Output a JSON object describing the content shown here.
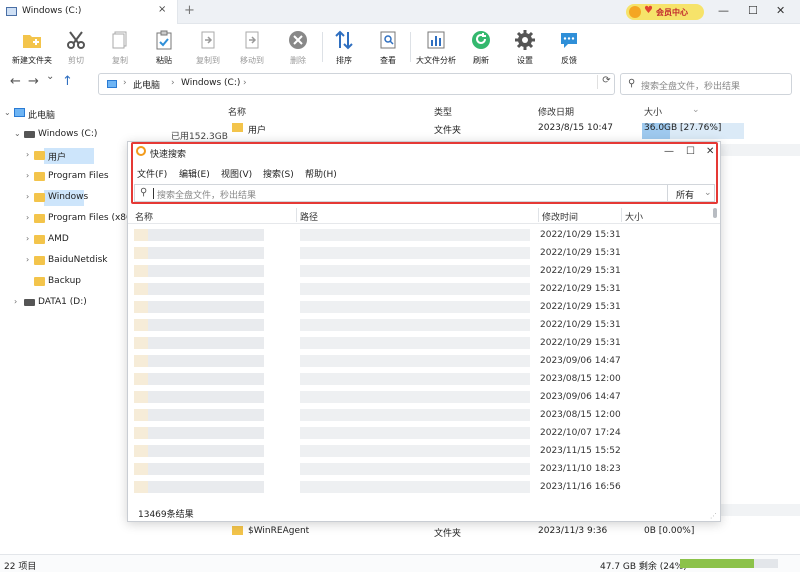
{
  "window": {
    "tab_title": "Windows (C:)",
    "tab_close": "×",
    "new_tab": "+",
    "vip_label": "会员中心",
    "controls": {
      "minimize": "—",
      "maximize": "☐",
      "close": "✕"
    }
  },
  "toolbar": {
    "buttons": [
      {
        "label": "新建文件夹",
        "icon": "new-folder-icon",
        "enabled": true
      },
      {
        "label": "剪切",
        "icon": "scissors-icon",
        "enabled": false
      },
      {
        "label": "复制",
        "icon": "copy-icon",
        "enabled": false
      },
      {
        "label": "粘贴",
        "icon": "paste-icon",
        "enabled": true
      },
      {
        "label": "复制到",
        "icon": "copy-to-icon",
        "enabled": false
      },
      {
        "label": "移动到",
        "icon": "move-to-icon",
        "enabled": false
      },
      {
        "label": "删除",
        "icon": "delete-icon",
        "enabled": false
      },
      {
        "label": "排序",
        "icon": "sort-icon",
        "enabled": true
      },
      {
        "label": "查看",
        "icon": "view-icon",
        "enabled": true
      },
      {
        "label": "大文件分析",
        "icon": "chart-icon",
        "enabled": true
      },
      {
        "label": "刷新",
        "icon": "refresh-icon",
        "enabled": true
      },
      {
        "label": "设置",
        "icon": "gear-icon",
        "enabled": true
      },
      {
        "label": "反馈",
        "icon": "feedback-icon",
        "enabled": true
      }
    ]
  },
  "nav": {
    "back": "←",
    "forward": "→",
    "down": "⌄",
    "up": "↑",
    "breadcrumb": [
      "此电脑",
      "Windows (C:)"
    ],
    "sep": "›",
    "refresh": "⟳",
    "search_placeholder": "搜索全盘文件，秒出结果"
  },
  "tree": {
    "root": "此电脑",
    "drive_c": "Windows (C:)",
    "drive_c_used": "已用152.3GB",
    "folders": [
      "用户",
      "Program Files",
      "Windows",
      "Program Files (x86)",
      "AMD",
      "BaiduNetdisk",
      "Backup"
    ],
    "drive_d": "DATA1 (D:)"
  },
  "filelist": {
    "headers": {
      "name": "名称",
      "type": "类型",
      "date": "修改日期",
      "size": "大小"
    },
    "rows": [
      {
        "name": "用户",
        "type": "文件夹",
        "date": "2023/8/15 10:47",
        "size": "36.0GB [27.76%]",
        "fraction": 0.2776
      },
      {
        "name": "$WinREAgent",
        "type": "文件夹",
        "date": "2023/11/3 9:36",
        "size": "0B [0.00%]",
        "fraction": 0
      }
    ]
  },
  "status": {
    "items": "22 项目",
    "free": "47.7 GB 剩余 (24%)",
    "used_fraction": 0.76
  },
  "quick_search": {
    "title": "快速搜索",
    "controls": {
      "minimize": "—",
      "maximize": "☐",
      "close": "✕"
    },
    "menu": [
      "文件(F)",
      "编辑(E)",
      "视图(V)",
      "搜索(S)",
      "帮助(H)"
    ],
    "search_placeholder": "搜索全盘文件，秒出结果",
    "scope": "所有",
    "columns": {
      "name": "名称",
      "path": "路径",
      "mtime": "修改时间",
      "size": "大小"
    },
    "times": [
      "2022/10/29 15:31",
      "2022/10/29 15:31",
      "2022/10/29 15:31",
      "2022/10/29 15:31",
      "2022/10/29 15:31",
      "2022/10/29 15:31",
      "2022/10/29 15:31",
      "2023/09/06 14:47",
      "2023/08/15 12:00",
      "2023/09/06 14:47",
      "2023/08/15 12:00",
      "2022/10/07 17:24",
      "2023/11/15 15:52",
      "2023/11/10 18:23",
      "2023/11/16 16:56"
    ],
    "result_count": "13469条结果"
  }
}
